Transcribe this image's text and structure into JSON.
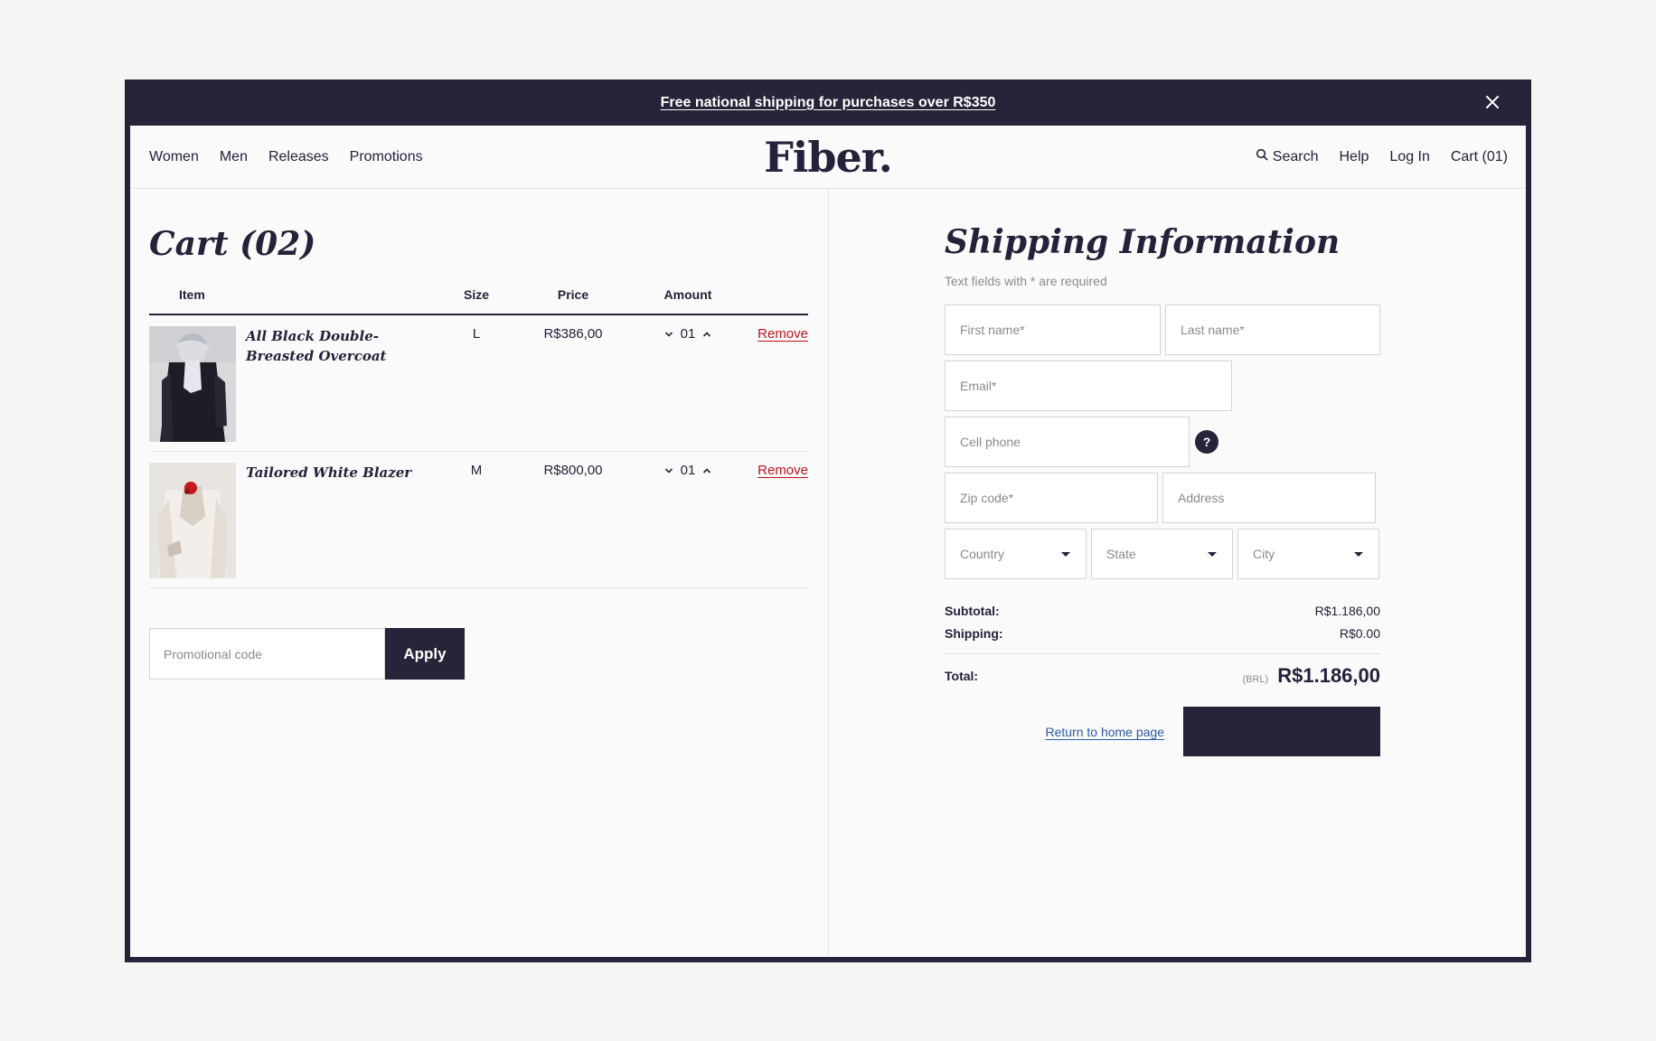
{
  "banner": {
    "text": "Free national shipping for purchases over R$350",
    "close_icon": "close-icon"
  },
  "header": {
    "logo": "Fiber.",
    "nav_left": [
      "Women",
      "Men",
      "Releases",
      "Promotions"
    ],
    "search_label": "Search",
    "help_label": "Help",
    "login_label": "Log In",
    "cart_label": "Cart (01)"
  },
  "cart": {
    "title": "Cart (02)",
    "columns": {
      "item": "Item",
      "size": "Size",
      "price": "Price",
      "amount": "Amount"
    },
    "items": [
      {
        "name": "All Black Double-Breasted Overcoat",
        "size": "L",
        "price": "R$386,00",
        "amount": "01",
        "remove": "Remove"
      },
      {
        "name": "Tailored White Blazer",
        "size": "M",
        "price": "R$800,00",
        "amount": "01",
        "remove": "Remove"
      }
    ],
    "promo_placeholder": "Promotional code",
    "apply_label": "Apply"
  },
  "shipping": {
    "title": "Shipping Information",
    "required_note": "Text fields with * are required",
    "first_name_placeholder": "First name*",
    "last_name_placeholder": "Last name*",
    "email_placeholder": "Email*",
    "cell_phone_placeholder": "Cell phone",
    "help_glyph": "?",
    "zip_placeholder": "Zip code*",
    "address_placeholder": "Address",
    "country_label": "Country",
    "state_label": "State",
    "city_label": "City"
  },
  "totals": {
    "subtotal_label": "Subtotal:",
    "subtotal_value": "R$1.186,00",
    "shipping_label": "Shipping:",
    "shipping_value": "R$0.00",
    "total_label": "Total:",
    "currency": "(BRL)",
    "total_value": "R$1.186,00"
  },
  "actions": {
    "return_label": "Return to home page",
    "checkout_label": ""
  },
  "colors": {
    "brand_dark": "#252438",
    "remove_red": "#c1121f",
    "link_blue": "#2d5aa6"
  }
}
